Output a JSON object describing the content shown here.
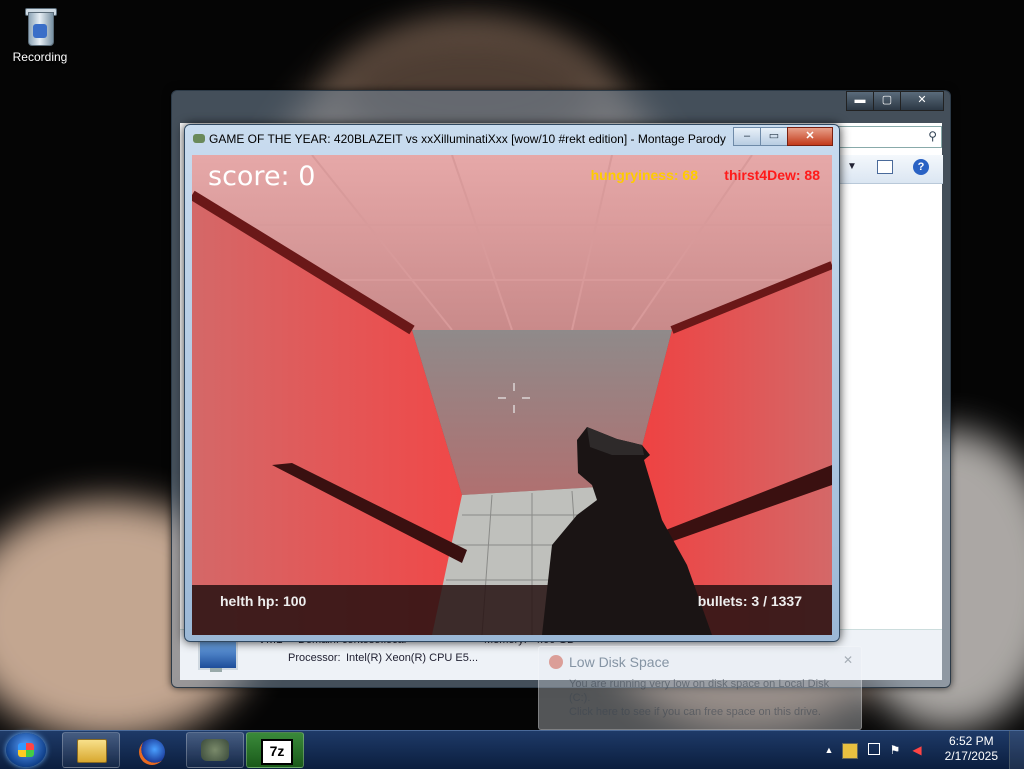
{
  "desktop": {
    "recycle_bin_label": "Recording"
  },
  "explorer": {
    "search_icon": "magnifier-icon",
    "toolbar": {
      "more_icon": "chevron-down-icon",
      "preview_pane_icon": "preview-pane-icon",
      "help_label": "?"
    },
    "window_buttons": {
      "minimize": "▬",
      "maximize": "▢",
      "close": "✕"
    },
    "details": {
      "name": "VM1",
      "domain_label": "Domain:",
      "domain_value": "contoso.local",
      "memory_label": "Memory:",
      "memory_value": "4.00 GB",
      "processor_label": "Processor:",
      "processor_value": "Intel(R) Xeon(R) CPU E5..."
    }
  },
  "game_window": {
    "title": "GAME OF THE YEAR: 420BLAZEIT vs xxXilluminatiXxx [wow/10 #rekt edition] - Montage Parody ...",
    "buttons": {
      "minimize": "–",
      "maximize": "▭",
      "close": "✕"
    },
    "hud": {
      "score": "score: 0",
      "hungryiness": "hungryiness: 68",
      "thirst": "thirst4Dew: 88",
      "health": "helth hp: 100",
      "bullets": "bullets: 3 / 1337"
    }
  },
  "notification": {
    "title": "Low Disk Space",
    "body_line1": "You are running very low on disk space on Local Disk (C:).",
    "body_line2": "Click here to see if you can free space on this drive."
  },
  "taskbar": {
    "apps": [
      {
        "name": "explorer",
        "icon": "folder-icon"
      },
      {
        "name": "firefox",
        "icon": "firefox-icon"
      },
      {
        "name": "game",
        "icon": "game-icon"
      },
      {
        "name": "7zip",
        "icon": "7zip-icon",
        "label": "7z"
      }
    ],
    "clock": {
      "time": "6:52 PM",
      "date": "2/17/2025"
    }
  },
  "colors": {
    "hungry": "#ffcc00",
    "thirst": "#ff1a1a",
    "taskbar": "#0b1e3e"
  }
}
